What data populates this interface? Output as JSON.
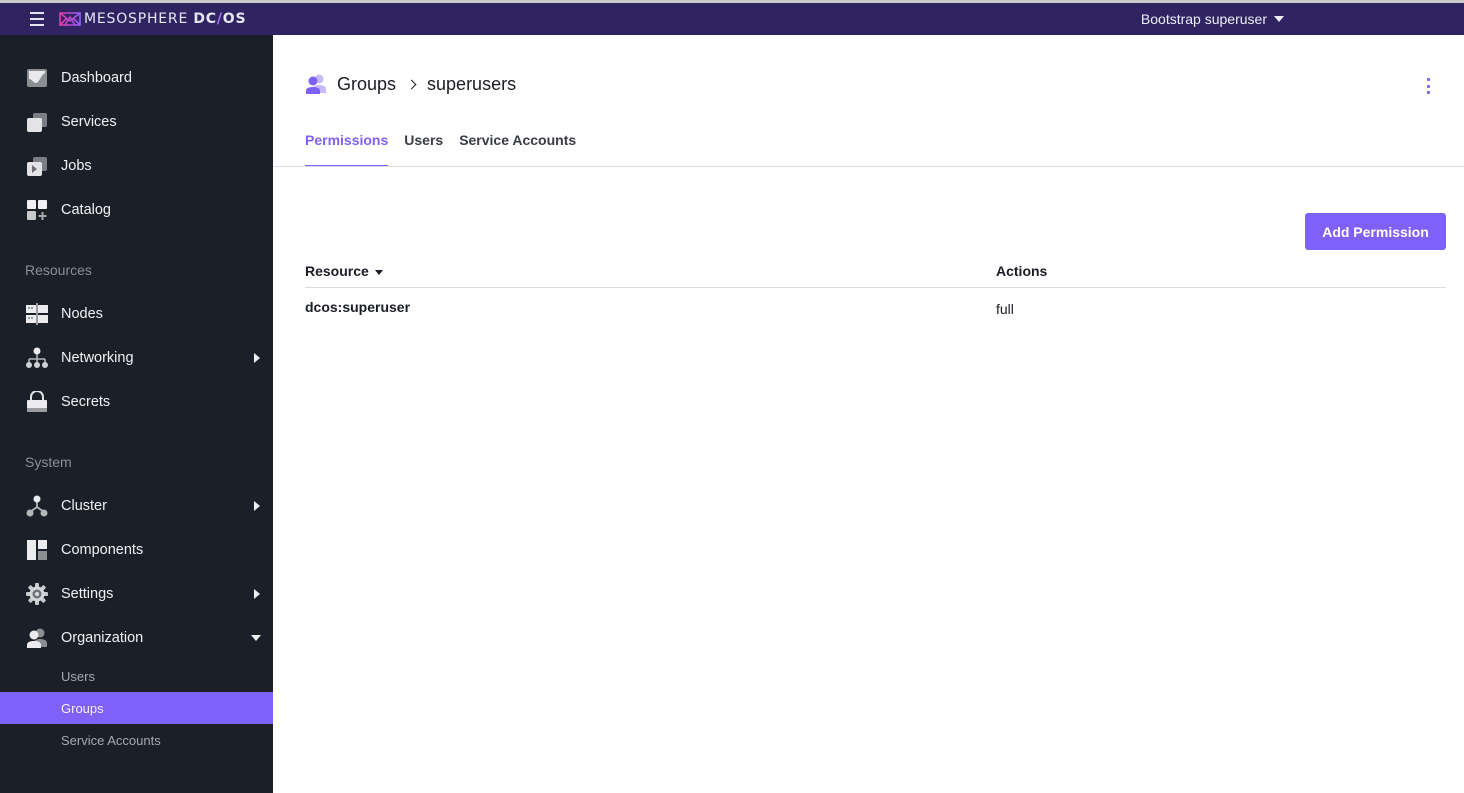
{
  "topbar": {
    "brand_light": "MESOSPHERE ",
    "brand_bold_1": "DC",
    "brand_slash": "/",
    "brand_bold_2": "OS",
    "user_menu_label": "Bootstrap superuser",
    "colors": {
      "background": "#2f2461",
      "accent": "#7e61f8"
    }
  },
  "sidebar": {
    "items": [
      {
        "label": "Dashboard",
        "icon": "dashboard-icon"
      },
      {
        "label": "Services",
        "icon": "services-icon"
      },
      {
        "label": "Jobs",
        "icon": "jobs-icon"
      },
      {
        "label": "Catalog",
        "icon": "catalog-icon"
      }
    ],
    "sections": [
      {
        "title": "Resources",
        "items": [
          {
            "label": "Nodes",
            "icon": "nodes-icon",
            "expandable": false
          },
          {
            "label": "Networking",
            "icon": "networking-icon",
            "expandable": true
          },
          {
            "label": "Secrets",
            "icon": "lock-icon",
            "expandable": false
          }
        ]
      },
      {
        "title": "System",
        "items": [
          {
            "label": "Cluster",
            "icon": "cluster-icon",
            "expandable": true
          },
          {
            "label": "Components",
            "icon": "components-icon",
            "expandable": false
          },
          {
            "label": "Settings",
            "icon": "gear-icon",
            "expandable": true
          },
          {
            "label": "Organization",
            "icon": "organization-icon",
            "expanded": true
          }
        ]
      }
    ],
    "organization_subitems": [
      {
        "label": "Users",
        "active": false
      },
      {
        "label": "Groups",
        "active": true
      },
      {
        "label": "Service Accounts",
        "active": false
      }
    ]
  },
  "main": {
    "breadcrumb": [
      "Groups",
      "superusers"
    ],
    "tabs": [
      {
        "label": "Permissions",
        "active": true
      },
      {
        "label": "Users",
        "active": false
      },
      {
        "label": "Service Accounts",
        "active": false
      }
    ],
    "add_button_label": "Add Permission",
    "table": {
      "columns": [
        "Resource",
        "Actions"
      ],
      "sort_column": "Resource",
      "rows": [
        {
          "resource": "dcos:superuser",
          "actions": "full"
        }
      ]
    }
  }
}
